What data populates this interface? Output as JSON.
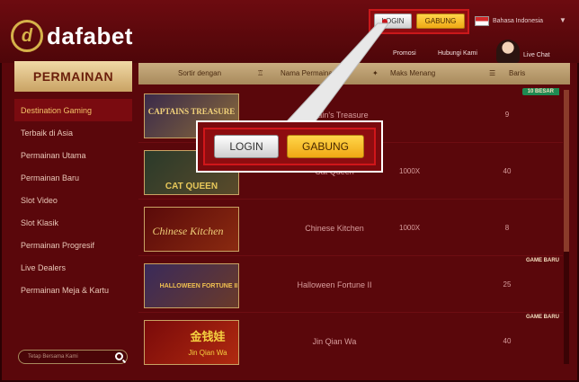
{
  "brand": {
    "logo_mark": "d",
    "logo_text": "dafabet"
  },
  "header": {
    "login_label": "LOGIN",
    "join_label": "GABUNG",
    "language": "Bahasa Indonesia",
    "links": {
      "promo": "Promosi",
      "contact": "Hubungi Kami",
      "live_chat": "Live Chat"
    }
  },
  "sidebar": {
    "title": "PERMAINAN",
    "items": [
      {
        "label": "Destination Gaming"
      },
      {
        "label": "Terbaik di Asia"
      },
      {
        "label": "Permainan Utama"
      },
      {
        "label": "Permainan Baru"
      },
      {
        "label": "Slot Video"
      },
      {
        "label": "Slot Klasik"
      },
      {
        "label": "Permainan Progresif"
      },
      {
        "label": "Live Dealers"
      },
      {
        "label": "Permainan Meja & Kartu"
      }
    ],
    "search_placeholder": "Tetap Bersama Kami"
  },
  "sortbar": {
    "label": "Sortir dengan",
    "name": "Nama Permainan",
    "max_win": "Maks Menang",
    "rows": "Baris"
  },
  "games": [
    {
      "name": "Captain's Treasure",
      "max": "",
      "lines": "9",
      "tag": "10 BESAR",
      "tag_style": "green"
    },
    {
      "name": "Cat Queen",
      "max": "1000X",
      "lines": "40",
      "tag": "",
      "tag_style": ""
    },
    {
      "name": "Chinese Kitchen",
      "max": "1000X",
      "lines": "8",
      "tag": "",
      "tag_style": ""
    },
    {
      "name": "Halloween Fortune II",
      "max": "",
      "lines": "25",
      "tag": "GAME BARU",
      "tag_style": "plain"
    },
    {
      "name": "Jin Qian Wa",
      "max": "",
      "lines": "40",
      "tag": "GAME BARU",
      "tag_style": "plain"
    }
  ],
  "thumbnails": {
    "captain": "CAPTAINS TREASURE",
    "cat": "CAT QUEEN",
    "chinese": "Chinese Kitchen",
    "halloween": "HALLOWEEN FORTUNE II",
    "jinqian_cn": "金钱娃",
    "jinqian_en": "Jin Qian Wa"
  },
  "popup": {
    "login_label": "LOGIN",
    "join_label": "GABUNG"
  },
  "colors": {
    "background": "#5a070b",
    "accent_gold": "#f0a814",
    "highlight_red": "#d0161a",
    "menu_active": "#f3c46a"
  }
}
